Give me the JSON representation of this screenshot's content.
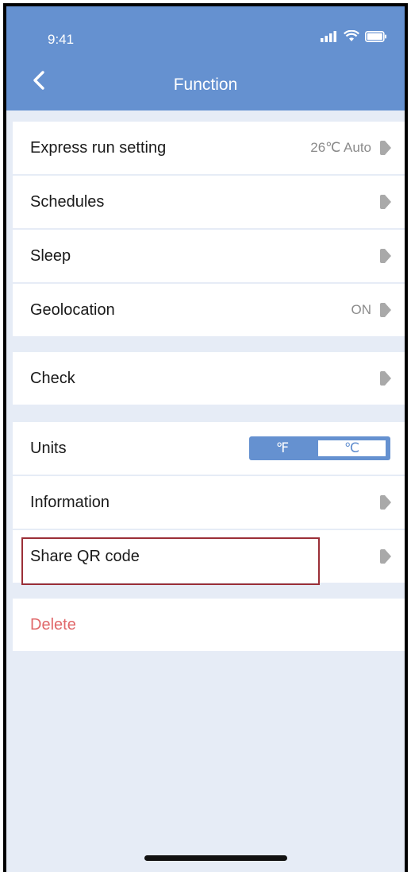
{
  "status_bar": {
    "time": "9:41"
  },
  "header": {
    "title": "Function"
  },
  "rows": {
    "express": {
      "label": "Express run setting",
      "value": "26℃ Auto"
    },
    "schedules": {
      "label": "Schedules"
    },
    "sleep": {
      "label": "Sleep"
    },
    "geolocation": {
      "label": "Geolocation",
      "value": "ON"
    },
    "check": {
      "label": "Check"
    },
    "units": {
      "label": "Units",
      "option_f": "℉",
      "option_c": "℃",
      "selected": "℃"
    },
    "information": {
      "label": "Information"
    },
    "share_qr": {
      "label": "Share QR code"
    },
    "delete": {
      "label": "Delete"
    }
  },
  "colors": {
    "accent": "#6591d0",
    "delete": "#e0686a",
    "background": "#e6ecf6",
    "highlight": "#9b2f37"
  }
}
